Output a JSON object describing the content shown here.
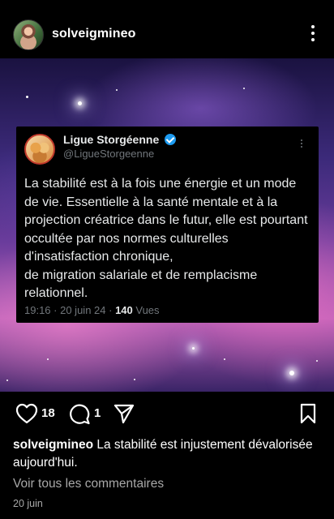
{
  "header": {
    "username": "solveigmineo"
  },
  "tweet": {
    "display_name": "Ligue Storgéenne",
    "handle": "@LigueStorgeenne",
    "body": "La stabilité est à la fois une énergie et un mode de vie. Essentielle à la santé mentale et à la projection créatrice dans le futur, elle est pourtant occultée par nos normes culturelles d'insatisfaction chronique,\nde migration salariale et de remplacisme relationnel.",
    "time": "19:16",
    "date": "20 juin 24",
    "views": "140",
    "views_label": "Vues"
  },
  "actions": {
    "likes": "18",
    "comments": "1"
  },
  "caption": {
    "username": "solveigmineo",
    "text": "La stabilité est injustement dévalorisée aujourd'hui.",
    "view_comments": "Voir tous les commentaires",
    "date": "20 juin"
  },
  "colors": {
    "background": "#000000",
    "verified": "#1d9bf0",
    "secondary_text": "#a8a8a8"
  },
  "icons": [
    "more-vertical-icon",
    "verified-badge-icon",
    "heart-icon",
    "comment-icon",
    "send-icon",
    "bookmark-icon"
  ]
}
